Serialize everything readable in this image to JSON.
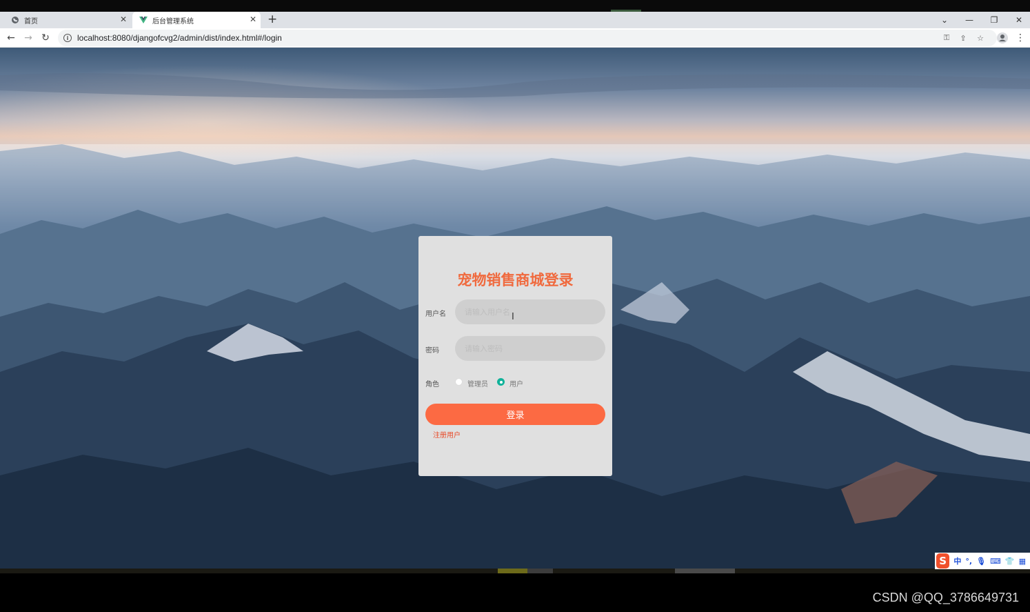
{
  "browser": {
    "tabs": [
      {
        "title": "首页",
        "icon": "globe-icon"
      },
      {
        "title": "后台管理系统",
        "icon": "vue-logo-icon"
      }
    ],
    "new_tab_glyph": "+",
    "url": "localhost:8080/djangofcvg2/admin/dist/index.html#/login"
  },
  "login": {
    "title": "宠物销售商城登录",
    "username_label": "用户名",
    "username_placeholder": "请输入用户名",
    "password_label": "密码",
    "password_placeholder": "请输入密码",
    "role_label": "角色",
    "roles": [
      {
        "label": "管理员",
        "selected": false
      },
      {
        "label": "用户",
        "selected": true
      }
    ],
    "login_button": "登录",
    "register_link": "注册用户"
  },
  "ime": {
    "mode": "中"
  },
  "watermark": "CSDN @QQ_3786649731",
  "colors": {
    "title": "#f06a3e",
    "button": "#fc6a43",
    "radio_checked": "#11b29a",
    "register_link": "#e84a28"
  }
}
